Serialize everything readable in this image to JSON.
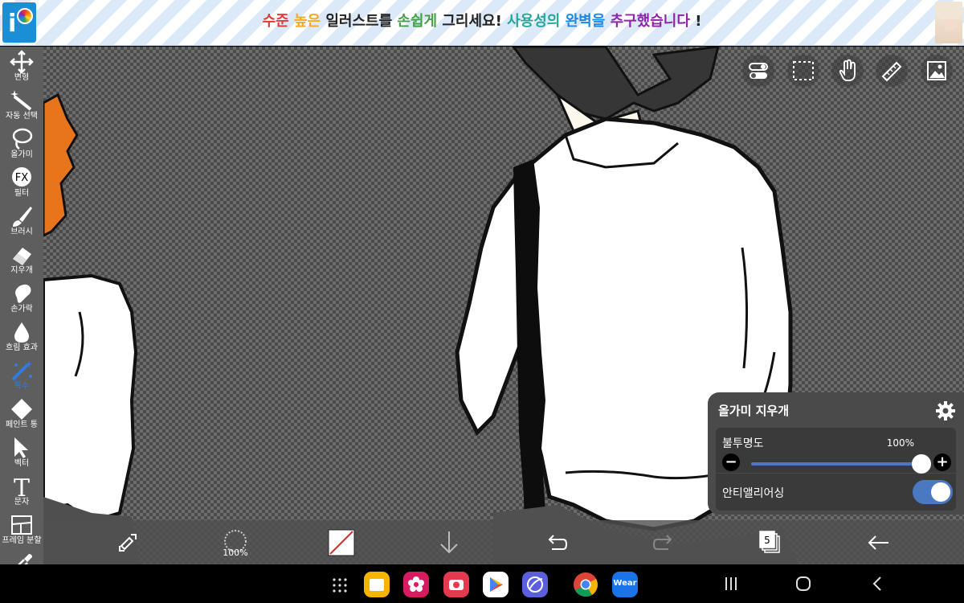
{
  "banner": {
    "slogan_parts": [
      {
        "text": "수준",
        "color": "#e53935"
      },
      {
        "text": " 높은",
        "color": "#f9a825"
      },
      {
        "text": " 일러스트를",
        "color": "#222222"
      },
      {
        "text": " 손쉽게",
        "color": "#43a047"
      },
      {
        "text": " 그리세요!",
        "color": "#222222"
      },
      {
        "text": " 사용성의",
        "color": "#26a69a"
      },
      {
        "text": " 완벽을",
        "color": "#1e88e5"
      },
      {
        "text": " 추구했습니다",
        "color": "#8e24aa"
      },
      {
        "text": " !",
        "color": "#222222"
      }
    ],
    "logo_text": "i"
  },
  "tools": [
    {
      "id": "transform",
      "label": "변형",
      "icon": "move-arrows-icon"
    },
    {
      "id": "auto-select",
      "label": "자동 선택",
      "icon": "magic-wand-icon"
    },
    {
      "id": "lasso",
      "label": "올가미",
      "icon": "lasso-icon"
    },
    {
      "id": "filter",
      "label": "필터",
      "icon": "fx-icon",
      "icon_text": "FX"
    },
    {
      "id": "brush",
      "label": "브러시",
      "icon": "brush-icon"
    },
    {
      "id": "eraser",
      "label": "지우개",
      "icon": "eraser-icon"
    },
    {
      "id": "smudge",
      "label": "손가락",
      "icon": "finger-icon"
    },
    {
      "id": "blur",
      "label": "흐림 효과",
      "icon": "drop-icon"
    },
    {
      "id": "special",
      "label": "특수",
      "icon": "special-wand-icon",
      "active": true
    },
    {
      "id": "fill",
      "label": "페인트 통",
      "icon": "paint-bucket-icon"
    },
    {
      "id": "vector",
      "label": "벡터",
      "icon": "cursor-icon"
    },
    {
      "id": "text",
      "label": "문자",
      "icon": "text-icon",
      "icon_text": "T"
    },
    {
      "id": "frame",
      "label": "프레임 분할",
      "icon": "frame-divider-icon"
    },
    {
      "id": "eyedropper",
      "label": "",
      "icon": "eyedropper-icon"
    }
  ],
  "top_icons": [
    "toggle-panel-icon",
    "selection-icon",
    "hand-icon",
    "ruler-icon",
    "gallery-icon"
  ],
  "panel": {
    "title": "올가미 지우개",
    "opacity_label": "불투명도",
    "opacity_value": "100%",
    "opacity_level": 1.0,
    "minus_symbol": "−",
    "plus_symbol": "+",
    "antialias_label": "안티앨리어싱",
    "antialias_on": true,
    "accent": "#4a79c2"
  },
  "bottom": {
    "brush_opacity": "100%",
    "layer_count": "5",
    "icons": [
      "swap-draw-erase-icon",
      "brush-size-icon",
      "color-swatch-icon",
      "down-arrow-icon",
      "undo-icon",
      "redo-icon",
      "layers-icon",
      "back-arrow-icon"
    ]
  },
  "navbar": {
    "apps": [
      {
        "name": "files-app",
        "color": "#f5b400"
      },
      {
        "name": "flower-app",
        "color": "#d81b60"
      },
      {
        "name": "camera-app",
        "color": "#e53950"
      },
      {
        "name": "play-store-app",
        "color": "#ffffff"
      },
      {
        "name": "internet-app",
        "color": "#5b5fde"
      },
      {
        "name": "chrome-app",
        "color": "#ffffff"
      },
      {
        "name": "wear-app",
        "color": "#1a73e8",
        "label": "Wear"
      }
    ],
    "keys": [
      "recents-icon",
      "home-icon",
      "back-icon"
    ]
  }
}
